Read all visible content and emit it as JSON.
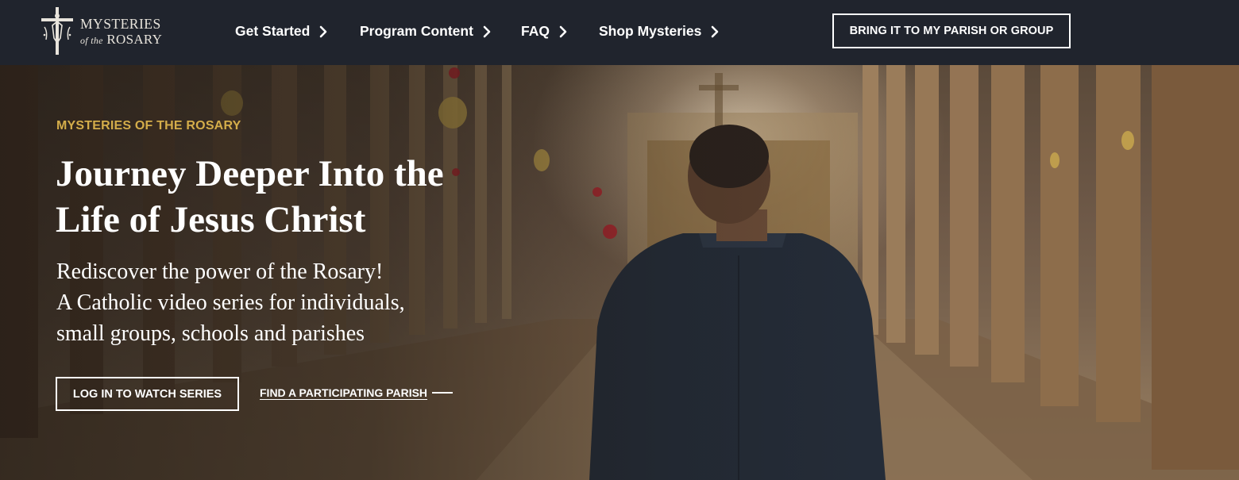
{
  "brand": {
    "line1": "MYSTERIES",
    "line2_of": "of the",
    "line2_main": "ROSARY",
    "logo_icon": "crucifix-icon"
  },
  "nav": {
    "items": [
      {
        "label": "Get Started",
        "icon": "chevron-right-icon"
      },
      {
        "label": "Program Content",
        "icon": "chevron-right-icon"
      },
      {
        "label": "FAQ",
        "icon": "chevron-right-icon"
      },
      {
        "label": "Shop Mysteries",
        "icon": "chevron-right-icon"
      }
    ],
    "cta_label": "BRING IT TO MY PARISH OR GROUP"
  },
  "hero": {
    "eyebrow": "MYSTERIES OF THE ROSARY",
    "headline": "Journey Deeper Into the Life of Jesus Christ",
    "subhead_lines": [
      "Rediscover the power of the Rosary!",
      "A Catholic video series for individuals,",
      "small groups, schools and parishes"
    ],
    "primary_button": "LOG IN TO WATCH SERIES",
    "secondary_link": "FIND A PARTICIPATING PARISH"
  },
  "colors": {
    "nav_bg": "#20242d",
    "accent_gold": "#d4ad4a",
    "text": "#ffffff"
  }
}
